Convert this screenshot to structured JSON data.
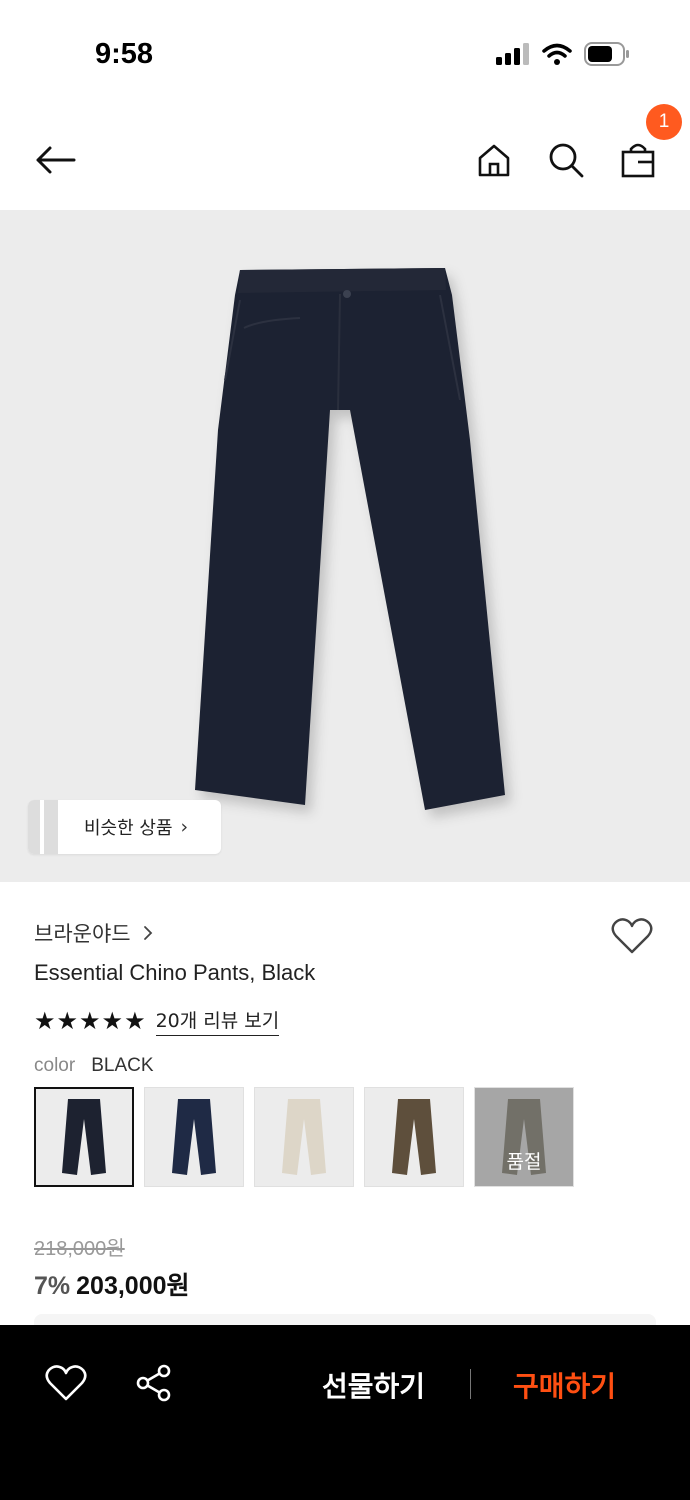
{
  "status_bar": {
    "time": "9:58"
  },
  "nav": {
    "cart_badge": "1"
  },
  "hero": {
    "similar_label": "비슷한 상품"
  },
  "product": {
    "brand": "브라운야드",
    "name": "Essential Chino Pants, Black",
    "rating_stars": 5,
    "review_link": "20개 리뷰 보기",
    "color_label": "color",
    "color_value": "BLACK",
    "swatches": [
      {
        "color": "#1d2230",
        "sold_out": false,
        "selected": true
      },
      {
        "color": "#1f2a45",
        "sold_out": false,
        "selected": false
      },
      {
        "color": "#ddd6c8",
        "sold_out": false,
        "selected": false
      },
      {
        "color": "#5e4f3c",
        "sold_out": false,
        "selected": false
      },
      {
        "color": "#6a6550",
        "sold_out": true,
        "sold_out_label": "품절",
        "selected": false
      }
    ],
    "original_price": "218,000원",
    "discount": "7%",
    "sale_price": "203,000원"
  },
  "bottom_bar": {
    "gift_label": "선물하기",
    "buy_label": "구매하기"
  },
  "colors": {
    "accent": "#ff4f12",
    "badge": "#ff5a1f",
    "hero_bg": "#ececec",
    "bottom_bar": "#000000"
  }
}
